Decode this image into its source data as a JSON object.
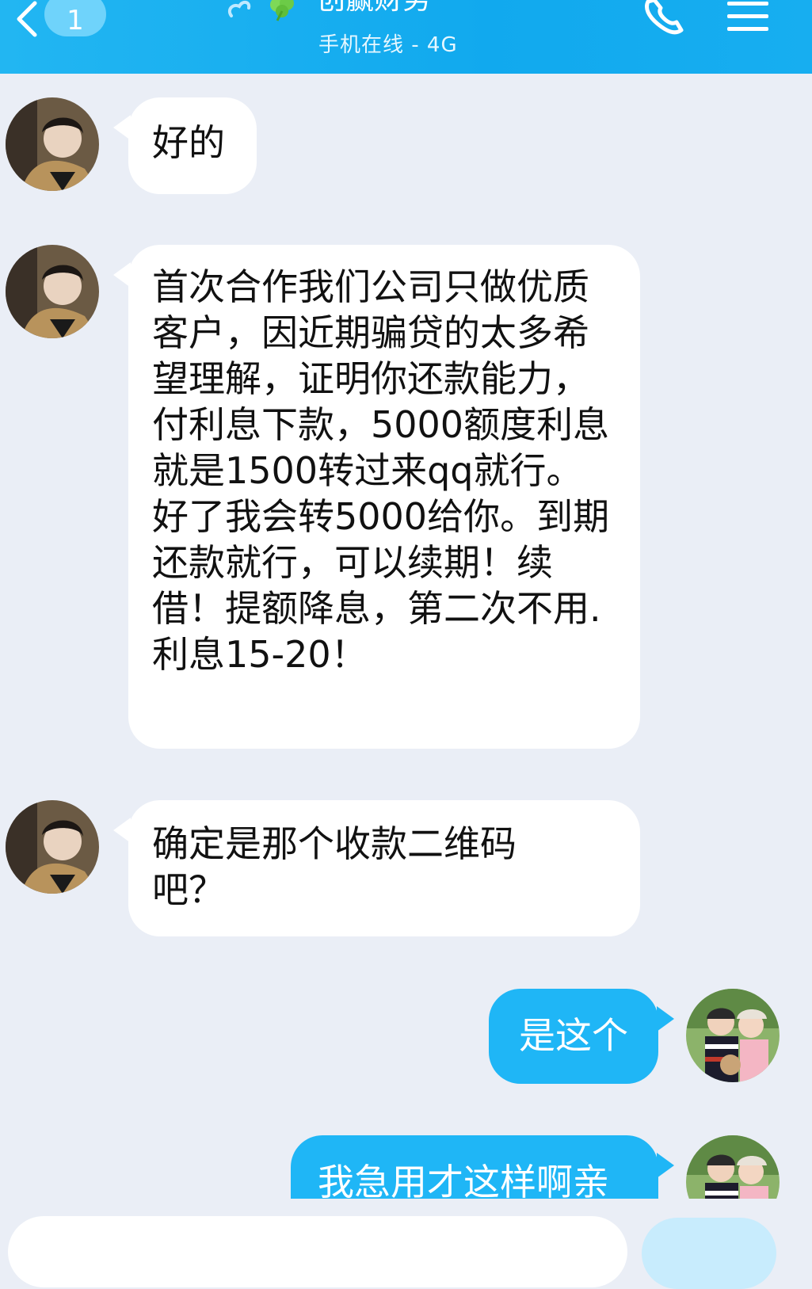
{
  "header": {
    "unread_count": "1",
    "title": "创赢财务",
    "subtitle": "手机在线 - 4G"
  },
  "colors": {
    "header_blue": "#12aaef",
    "chat_background": "#eaeef6",
    "my_bubble": "#1fb6f6",
    "their_bubble": "#ffffff"
  },
  "icons": {
    "back": "chevron-left-icon",
    "call": "phone-icon",
    "menu": "hamburger-menu-icon",
    "title_decoration": "clover-leaf-icon"
  },
  "messages": [
    {
      "sender": "contact",
      "text": "好的"
    },
    {
      "sender": "contact",
      "text": "首次合作我们公司只做优质客户，因近期骗贷的太多希望理解，证明你还款能力，付利息下款，5000额度利息就是1500转过来qq就行。好了我会转5000给你。到期还款就行，可以续期！续借！提额降息，第二次不用.利息15-20！"
    },
    {
      "sender": "contact",
      "text": "确定是那个收款二维码吧？"
    },
    {
      "sender": "me",
      "text": "是这个"
    },
    {
      "sender": "me",
      "text": "我急用才这样啊亲"
    }
  ]
}
